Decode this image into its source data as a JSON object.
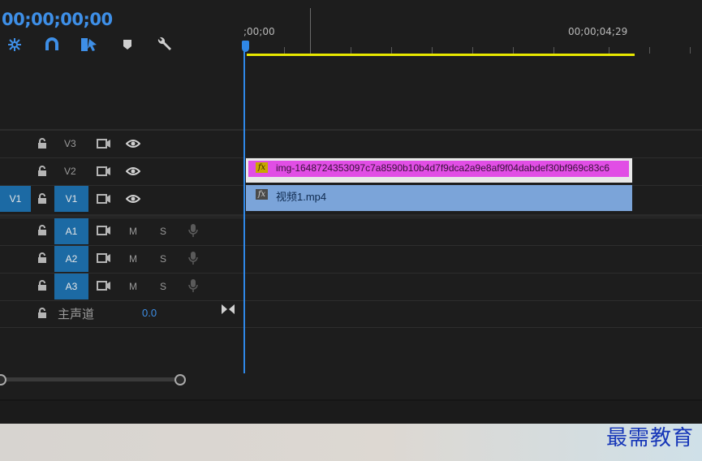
{
  "timeline": {
    "timecode": "00;00;00;00",
    "ruler": {
      "start_label": ";00;00",
      "end_label": "00;00;04;29"
    },
    "tools": [
      {
        "name": "snap-nest-icon"
      },
      {
        "name": "magnet-snap-icon"
      },
      {
        "name": "linked-selection-icon"
      },
      {
        "name": "add-marker-icon"
      },
      {
        "name": "wrench-settings-icon"
      }
    ]
  },
  "tracks": {
    "video": [
      {
        "id": "V3",
        "source": ""
      },
      {
        "id": "V2",
        "source": ""
      },
      {
        "id": "V1",
        "source": "V1"
      }
    ],
    "audio": [
      {
        "id": "A1",
        "mute": "M",
        "solo": "S"
      },
      {
        "id": "A2",
        "mute": "M",
        "solo": "S"
      },
      {
        "id": "A3",
        "mute": "M",
        "solo": "S"
      }
    ],
    "master": {
      "label": "主声道",
      "value": "0.0"
    }
  },
  "clips": {
    "image": {
      "name": "img-1648724353097c7a8590b10b4d7f9dca2a9e8af9f04dabdef30bf969c83c6",
      "fx": "fx",
      "color": "#e14ee5"
    },
    "video": {
      "name": "视频1.mp4",
      "fx": "fx",
      "color": "#7ba4d9"
    }
  },
  "colors": {
    "accent": "#2f87e6",
    "work_area": "#e8e800",
    "track_target": "#1c6aa4"
  },
  "watermark": "最需教育"
}
